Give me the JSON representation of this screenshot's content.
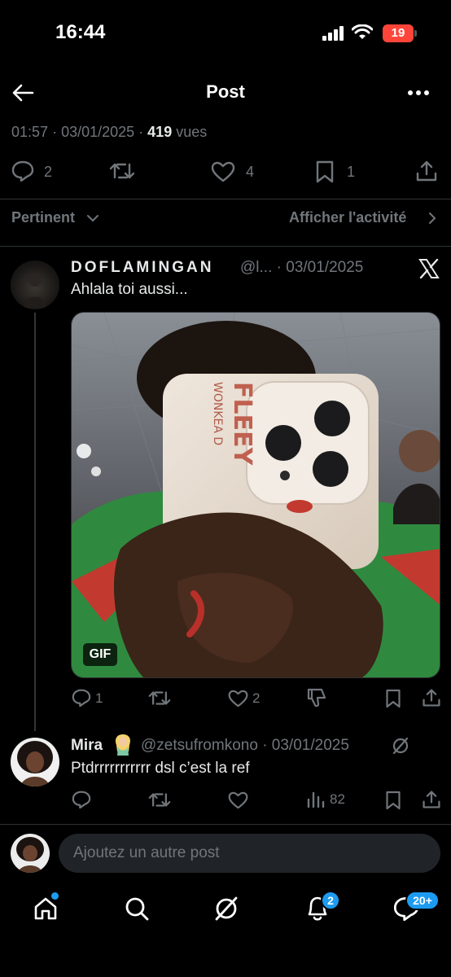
{
  "status": {
    "time": "16:44",
    "battery": "19"
  },
  "header": {
    "title": "Post"
  },
  "post": {
    "time": "01:57",
    "date": "03/01/2025",
    "views_count": "419",
    "views_label": "vues",
    "replies": "2",
    "likes": "4",
    "bookmarks": "1"
  },
  "filter": {
    "sort": "Pertinent",
    "activity": "Afficher l'activité"
  },
  "reply1": {
    "name": "DOFLAMINGAN",
    "handle": "@l...",
    "date": "03/01/2025",
    "text": "Ahlala toi aussi...",
    "gif_label": "GIF",
    "media_text_top": "WONKEA D",
    "media_text_bottom": "FLEEY",
    "replies": "1",
    "likes": "2"
  },
  "reply2": {
    "name": "Mira",
    "handle": "@zetsufromkono",
    "date": "03/01/2025",
    "text": "Ptdrrrrrrrrrrr dsl c’est la ref",
    "views": "82"
  },
  "composer": {
    "placeholder": "Ajoutez un autre post"
  },
  "nav": {
    "notifications_badge": "2",
    "messages_badge": "20+"
  }
}
